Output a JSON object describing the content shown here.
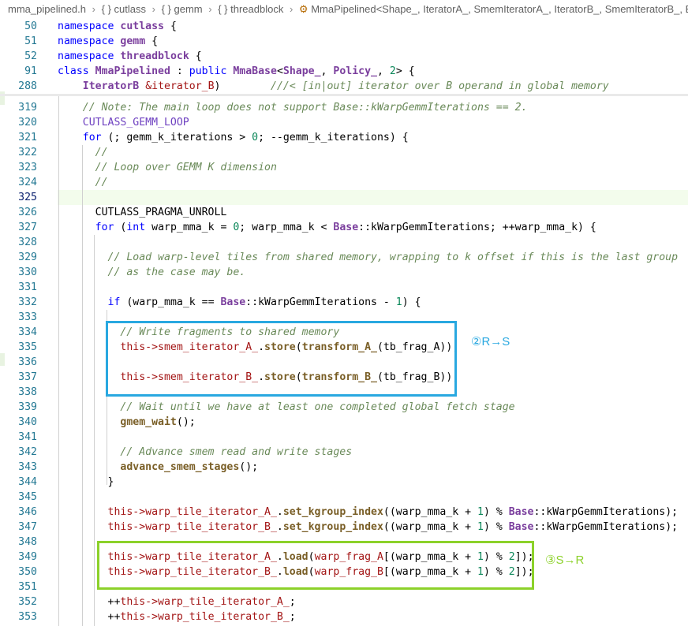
{
  "breadcrumb": {
    "file": "mma_pipelined.h",
    "items": [
      "{ } cutlass",
      "{ } gemm",
      "{ } threadblock"
    ],
    "symbol": "MmaPipelined<Shape_, IteratorA_, SmemIteratorA_, IteratorB_, SmemIteratorB_, Eler"
  },
  "sticky_lines": [
    {
      "num": "50",
      "html": "<span class='kw'>namespace</span> <span class='cls'>cutlass</span> {"
    },
    {
      "num": "51",
      "html": "<span class='kw'>namespace</span> <span class='cls'>gemm</span> {"
    },
    {
      "num": "52",
      "html": "<span class='kw'>namespace</span> <span class='cls'>threadblock</span> {"
    },
    {
      "num": "91",
      "html": "<span class='kw'>class</span> <span class='cls'>MmaPipelined</span> : <span class='kw'>public</span> <span class='cls'>MmaBase</span>&lt;<span class='cls'>Shape_</span>, <span class='cls'>Policy_</span>, <span class='num'>2</span>&gt; {"
    },
    {
      "num": "288",
      "html": "    <span class='cls'>IteratorB</span> <span class='ptr'>&amp;iterator_B</span>)        <span class='cm'>///&lt; [in|out] iterator over B operand in global memory</span>"
    }
  ],
  "code_lines": [
    {
      "num": "319",
      "html": "    <span class='cm'>// Note: The main loop does not support Base::kWarpGemmIterations == 2.</span>"
    },
    {
      "num": "320",
      "html": "    <span class='mac'>CUTLASS_GEMM_LOOP</span>"
    },
    {
      "num": "321",
      "html": "    <span class='kw'>for</span> (; gemm_k_iterations &gt; <span class='num'>0</span>; --gemm_k_iterations) {"
    },
    {
      "num": "322",
      "html": "      <span class='cm'>//</span>"
    },
    {
      "num": "323",
      "html": "      <span class='cm'>// Loop over GEMM K dimension</span>"
    },
    {
      "num": "324",
      "html": "      <span class='cm'>//</span>"
    },
    {
      "num": "325",
      "html": "",
      "current": true
    },
    {
      "num": "326",
      "html": "      CUTLASS_PRAGMA_UNROLL"
    },
    {
      "num": "327",
      "html": "      <span class='kw'>for</span> (<span class='kw'>int</span> warp_mma_k = <span class='num'>0</span>; warp_mma_k &lt; <span class='cls'>Base</span>::kWarpGemmIterations; ++warp_mma_k) {"
    },
    {
      "num": "328",
      "html": ""
    },
    {
      "num": "329",
      "html": "        <span class='cm'>// Load warp-level tiles from shared memory, wrapping to k offset if this is the last group</span>"
    },
    {
      "num": "330",
      "html": "        <span class='cm'>// as the case may be.</span>"
    },
    {
      "num": "331",
      "html": ""
    },
    {
      "num": "332",
      "html": "        <span class='kw'>if</span> (warp_mma_k == <span class='cls'>Base</span>::kWarpGemmIterations - <span class='num'>1</span>) {"
    },
    {
      "num": "333",
      "html": ""
    },
    {
      "num": "334",
      "html": "          <span class='cm'>// Write fragments to shared memory</span>"
    },
    {
      "num": "335",
      "html": "          <span class='ptr'>this-&gt;</span><span class='mem'>smem_iterator_A_</span>.<span class='fn'>store</span>(<span class='fn'>transform_A_</span>(tb_frag_A));"
    },
    {
      "num": "336",
      "html": ""
    },
    {
      "num": "337",
      "html": "          <span class='ptr'>this-&gt;</span><span class='mem'>smem_iterator_B_</span>.<span class='fn'>store</span>(<span class='fn'>transform_B_</span>(tb_frag_B));"
    },
    {
      "num": "338",
      "html": ""
    },
    {
      "num": "339",
      "html": "          <span class='cm'>// Wait until we have at least one completed global fetch stage</span>"
    },
    {
      "num": "340",
      "html": "          <span class='fn'>gmem_wait</span>();"
    },
    {
      "num": "341",
      "html": ""
    },
    {
      "num": "342",
      "html": "          <span class='cm'>// Advance smem read and write stages</span>"
    },
    {
      "num": "343",
      "html": "          <span class='fn'>advance_smem_stages</span>();"
    },
    {
      "num": "344",
      "html": "        }"
    },
    {
      "num": "345",
      "html": ""
    },
    {
      "num": "346",
      "html": "        <span class='ptr'>this-&gt;</span><span class='mem'>warp_tile_iterator_A_</span>.<span class='fn'>set_kgroup_index</span>((warp_mma_k + <span class='num'>1</span>) % <span class='cls'>Base</span>::kWarpGemmIterations);"
    },
    {
      "num": "347",
      "html": "        <span class='ptr'>this-&gt;</span><span class='mem'>warp_tile_iterator_B_</span>.<span class='fn'>set_kgroup_index</span>((warp_mma_k + <span class='num'>1</span>) % <span class='cls'>Base</span>::kWarpGemmIterations);"
    },
    {
      "num": "348",
      "html": ""
    },
    {
      "num": "349",
      "html": "        <span class='ptr'>this-&gt;</span><span class='mem'>warp_tile_iterator_A_</span>.<span class='fn'>load</span>(<span class='mem'>warp_frag_A</span>[(warp_mma_k + <span class='num'>1</span>) % <span class='num'>2</span>]);"
    },
    {
      "num": "350",
      "html": "        <span class='ptr'>this-&gt;</span><span class='mem'>warp_tile_iterator_B_</span>.<span class='fn'>load</span>(<span class='mem'>warp_frag_B</span>[(warp_mma_k + <span class='num'>1</span>) % <span class='num'>2</span>]);"
    },
    {
      "num": "351",
      "html": ""
    },
    {
      "num": "352",
      "html": "        ++<span class='ptr'>this-&gt;</span><span class='mem'>warp_tile_iterator_A_</span>;"
    },
    {
      "num": "353",
      "html": "        ++<span class='ptr'>this-&gt;</span><span class='mem'>warp_tile_iterator_B_</span>;"
    }
  ],
  "annotations": {
    "blue": "②R→S",
    "green": "③S→R"
  },
  "colors": {
    "blue_box": "#29a8e0",
    "green_box": "#8cd12a",
    "current_line_bg": "#f3fcec"
  }
}
